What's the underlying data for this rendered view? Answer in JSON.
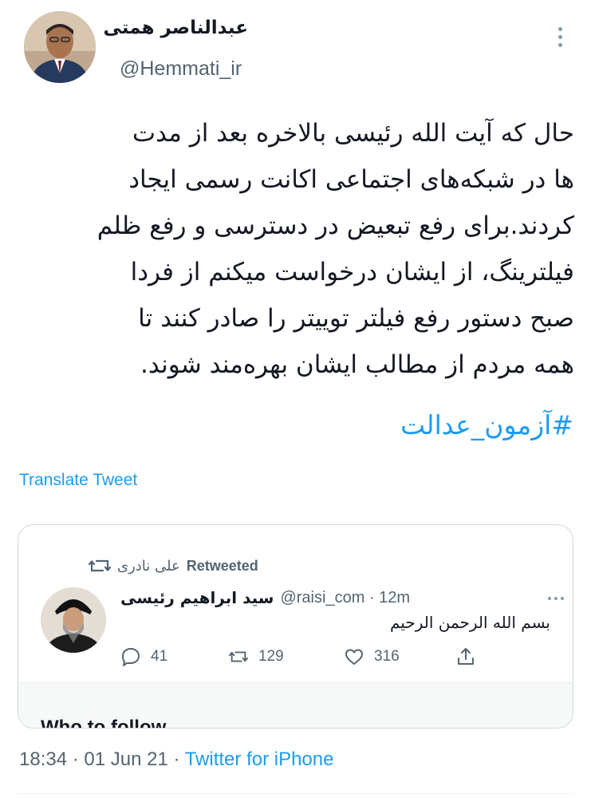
{
  "author": {
    "name": "عبدالناصر همتی",
    "handle": "@Hemmati_ir"
  },
  "tweet": {
    "lines": [
      "حال که آیت الله رئیسی بالاخره بعد از مدت",
      "ها در شبکه‌های اجتماعی اکانت رسمی ایجاد",
      "کردند.برای رفع تبعیض در دسترسی و رفع ظلم",
      "فیلترینگ، از ایشان درخواست میکنم از فردا",
      "صبح دستور رفع فیلتر توییتر را صادر کنند تا",
      "همه مردم از مطالب ایشان بهره‌مند شوند."
    ],
    "hashtag": "#آزمون_عدالت",
    "translate_label": "Translate Tweet"
  },
  "quoted": {
    "retweeted_by": "علی نادری",
    "retweeted_label": "Retweeted",
    "name": "سید ابراهیم رئیسی",
    "handle": "@raisi_com · 12m",
    "text": "بسم الله الرحمن الرحیم",
    "replies": "41",
    "retweets": "129",
    "likes": "316",
    "below_heading": "Who to follow"
  },
  "meta": {
    "time": "18:34",
    "date": "01 Jun 21",
    "separator": " · ",
    "source": "Twitter for iPhone"
  },
  "colors": {
    "link": "#1d9bf0",
    "muted": "#536471",
    "text": "#141823",
    "border": "#cfd9de"
  },
  "icons": [
    "more-vertical-icon",
    "retweet-icon",
    "reply-icon",
    "like-icon",
    "share-icon",
    "more-horizontal-icon"
  ]
}
